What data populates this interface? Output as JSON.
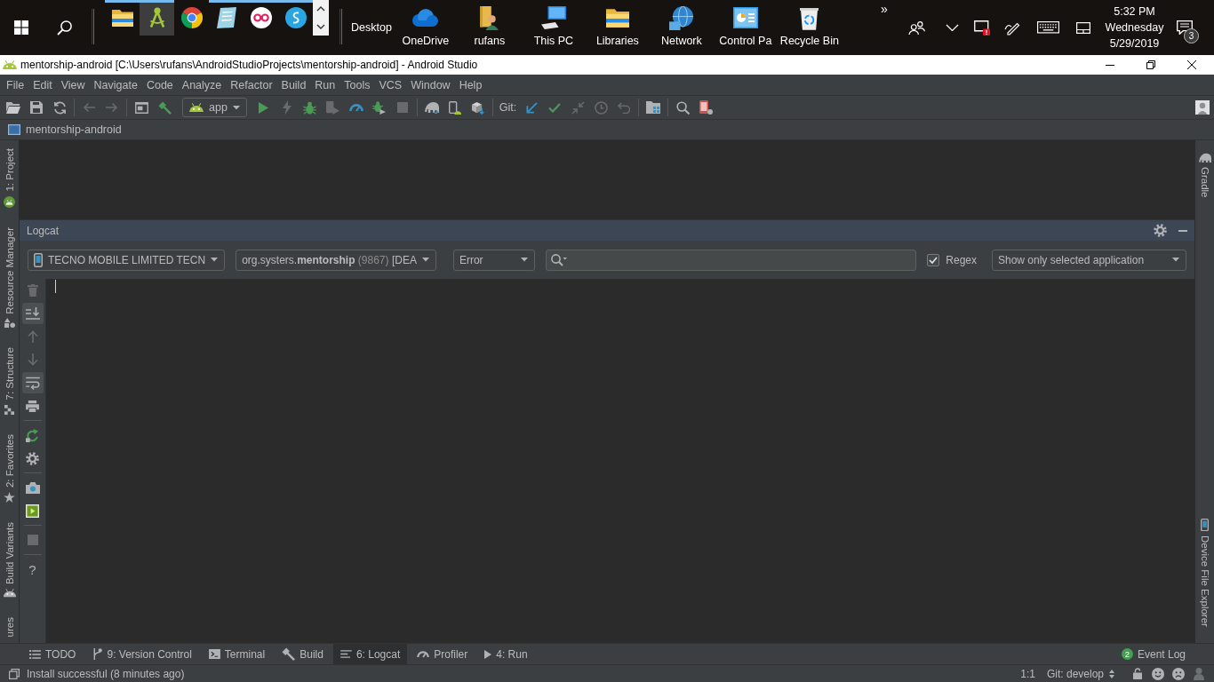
{
  "taskbar": {
    "pinned_apps": [
      {
        "kind": "folder",
        "running": true,
        "selected": false
      },
      {
        "kind": "compass",
        "running": true,
        "selected": true
      },
      {
        "kind": "browser",
        "running": false,
        "selected": false
      },
      {
        "kind": "notepad",
        "running": true,
        "selected": false
      },
      {
        "kind": "rings",
        "running": true,
        "selected": false
      },
      {
        "kind": "swirl",
        "running": true,
        "selected": false
      }
    ],
    "toolbar_label": "Desktop",
    "shortcuts": [
      {
        "label": "OneDrive",
        "kind": "cloud"
      },
      {
        "label": "rufans",
        "kind": "user-folder"
      },
      {
        "label": "This PC",
        "kind": "computer"
      },
      {
        "label": "Libraries",
        "kind": "folder"
      },
      {
        "label": "Network",
        "kind": "globe"
      },
      {
        "label": "Control Pa",
        "kind": "control-panel"
      },
      {
        "label": "Recycle Bin",
        "kind": "bin"
      }
    ],
    "overflow": "»",
    "clock": {
      "time": "5:32 PM",
      "day": "Wednesday",
      "date": "5/29/2019"
    },
    "notification_count": "3"
  },
  "window": {
    "title": "mentorship-android [C:\\Users\\rufans\\AndroidStudioProjects\\mentorship-android] - Android Studio"
  },
  "menu": [
    "File",
    "Edit",
    "View",
    "Navigate",
    "Code",
    "Analyze",
    "Refactor",
    "Build",
    "Run",
    "Tools",
    "VCS",
    "Window",
    "Help"
  ],
  "toolbar": {
    "groups": [
      [
        {
          "kind": "open",
          "disabled": false
        },
        {
          "kind": "save",
          "disabled": false
        },
        {
          "kind": "sync",
          "disabled": false
        }
      ],
      [
        {
          "kind": "back",
          "disabled": true
        },
        {
          "kind": "forward",
          "disabled": true
        }
      ],
      [
        {
          "kind": "window",
          "disabled": false
        },
        {
          "kind": "hammer",
          "disabled": false
        },
        {
          "kind": "config",
          "label": "app",
          "disabled": false
        },
        {
          "kind": "run",
          "disabled": false
        },
        {
          "kind": "apply",
          "disabled": true
        },
        {
          "kind": "debug",
          "disabled": false
        },
        {
          "kind": "attach",
          "disabled": true
        },
        {
          "kind": "profile",
          "disabled": false
        },
        {
          "kind": "attach-debugger",
          "disabled": false
        },
        {
          "kind": "stop",
          "disabled": true
        }
      ],
      [
        {
          "kind": "gradle-sync",
          "disabled": false
        },
        {
          "kind": "avd",
          "disabled": false
        },
        {
          "kind": "sdk",
          "disabled": false
        }
      ],
      [
        {
          "kind": "label",
          "label": "Git:",
          "disabled": false
        },
        {
          "kind": "update",
          "disabled": false
        },
        {
          "kind": "commit",
          "disabled": false
        },
        {
          "kind": "compare",
          "disabled": true
        },
        {
          "kind": "history",
          "disabled": true
        },
        {
          "kind": "rollback",
          "disabled": true
        }
      ],
      [
        {
          "kind": "project-structure",
          "disabled": false
        }
      ],
      [
        {
          "kind": "search",
          "disabled": false
        },
        {
          "kind": "device-manager",
          "disabled": false
        }
      ]
    ]
  },
  "navigation": {
    "breadcrumb": "mentorship-android"
  },
  "left_stripe": [
    {
      "label": "1: Project",
      "kind": "android-badge"
    },
    {
      "label": "Resource Manager",
      "kind": "shapes"
    },
    {
      "label": "7: Structure",
      "kind": "structure"
    },
    {
      "label": "2: Favorites",
      "kind": "star"
    },
    {
      "label": "Build Variants",
      "kind": "android"
    },
    {
      "label": "ures",
      "kind": "text"
    }
  ],
  "right_stripe": [
    {
      "label": "Gradle",
      "kind": "elephant"
    },
    {
      "label": "Device File Explorer",
      "kind": "phone"
    }
  ],
  "logcat": {
    "title": "Logcat",
    "device": "TECNO MOBILE LIMITED TECN",
    "process": {
      "name": "org.systers.**mentorship**",
      "pid": "(9867)",
      "state": "[DEA"
    },
    "level": "Error",
    "regex": {
      "label": "Regex",
      "checked": true
    },
    "filter": "Show only selected application",
    "tool_groups": [
      [
        {
          "kind": "trash",
          "disabled": true,
          "on": false
        },
        {
          "kind": "scroll-end",
          "disabled": false,
          "on": true
        },
        {
          "kind": "up",
          "disabled": true,
          "on": false
        },
        {
          "kind": "down",
          "disabled": true,
          "on": false
        },
        {
          "kind": "wrap",
          "disabled": false,
          "on": true
        },
        {
          "kind": "print",
          "disabled": false,
          "on": false
        }
      ],
      [
        {
          "kind": "restart",
          "disabled": false,
          "on": false
        },
        {
          "kind": "settings",
          "disabled": false,
          "on": false
        }
      ],
      [
        {
          "kind": "screenshot",
          "disabled": false,
          "on": false
        },
        {
          "kind": "record",
          "disabled": false,
          "on": false
        }
      ],
      [
        {
          "kind": "stop",
          "disabled": true,
          "on": false
        }
      ],
      [
        {
          "kind": "help",
          "label": "?",
          "disabled": false,
          "on": false
        }
      ]
    ]
  },
  "tool_tabs": [
    {
      "label": "TODO",
      "kind": "list",
      "selected": false
    },
    {
      "label": "9: Version Control",
      "kind": "branch",
      "selected": false
    },
    {
      "label": "Terminal",
      "kind": "terminal",
      "selected": false
    },
    {
      "label": "Build",
      "kind": "hammer",
      "selected": false
    },
    {
      "label": "6: Logcat",
      "kind": "logcat",
      "selected": true
    },
    {
      "label": "Profiler",
      "kind": "gauge",
      "selected": false
    },
    {
      "label": "4: Run",
      "kind": "play",
      "selected": false
    }
  ],
  "event_log": {
    "label": "Event Log",
    "count": "2"
  },
  "status_bar": {
    "message": "Install successful (8 minutes ago)",
    "position": "1:1",
    "branch": "Git: develop"
  }
}
